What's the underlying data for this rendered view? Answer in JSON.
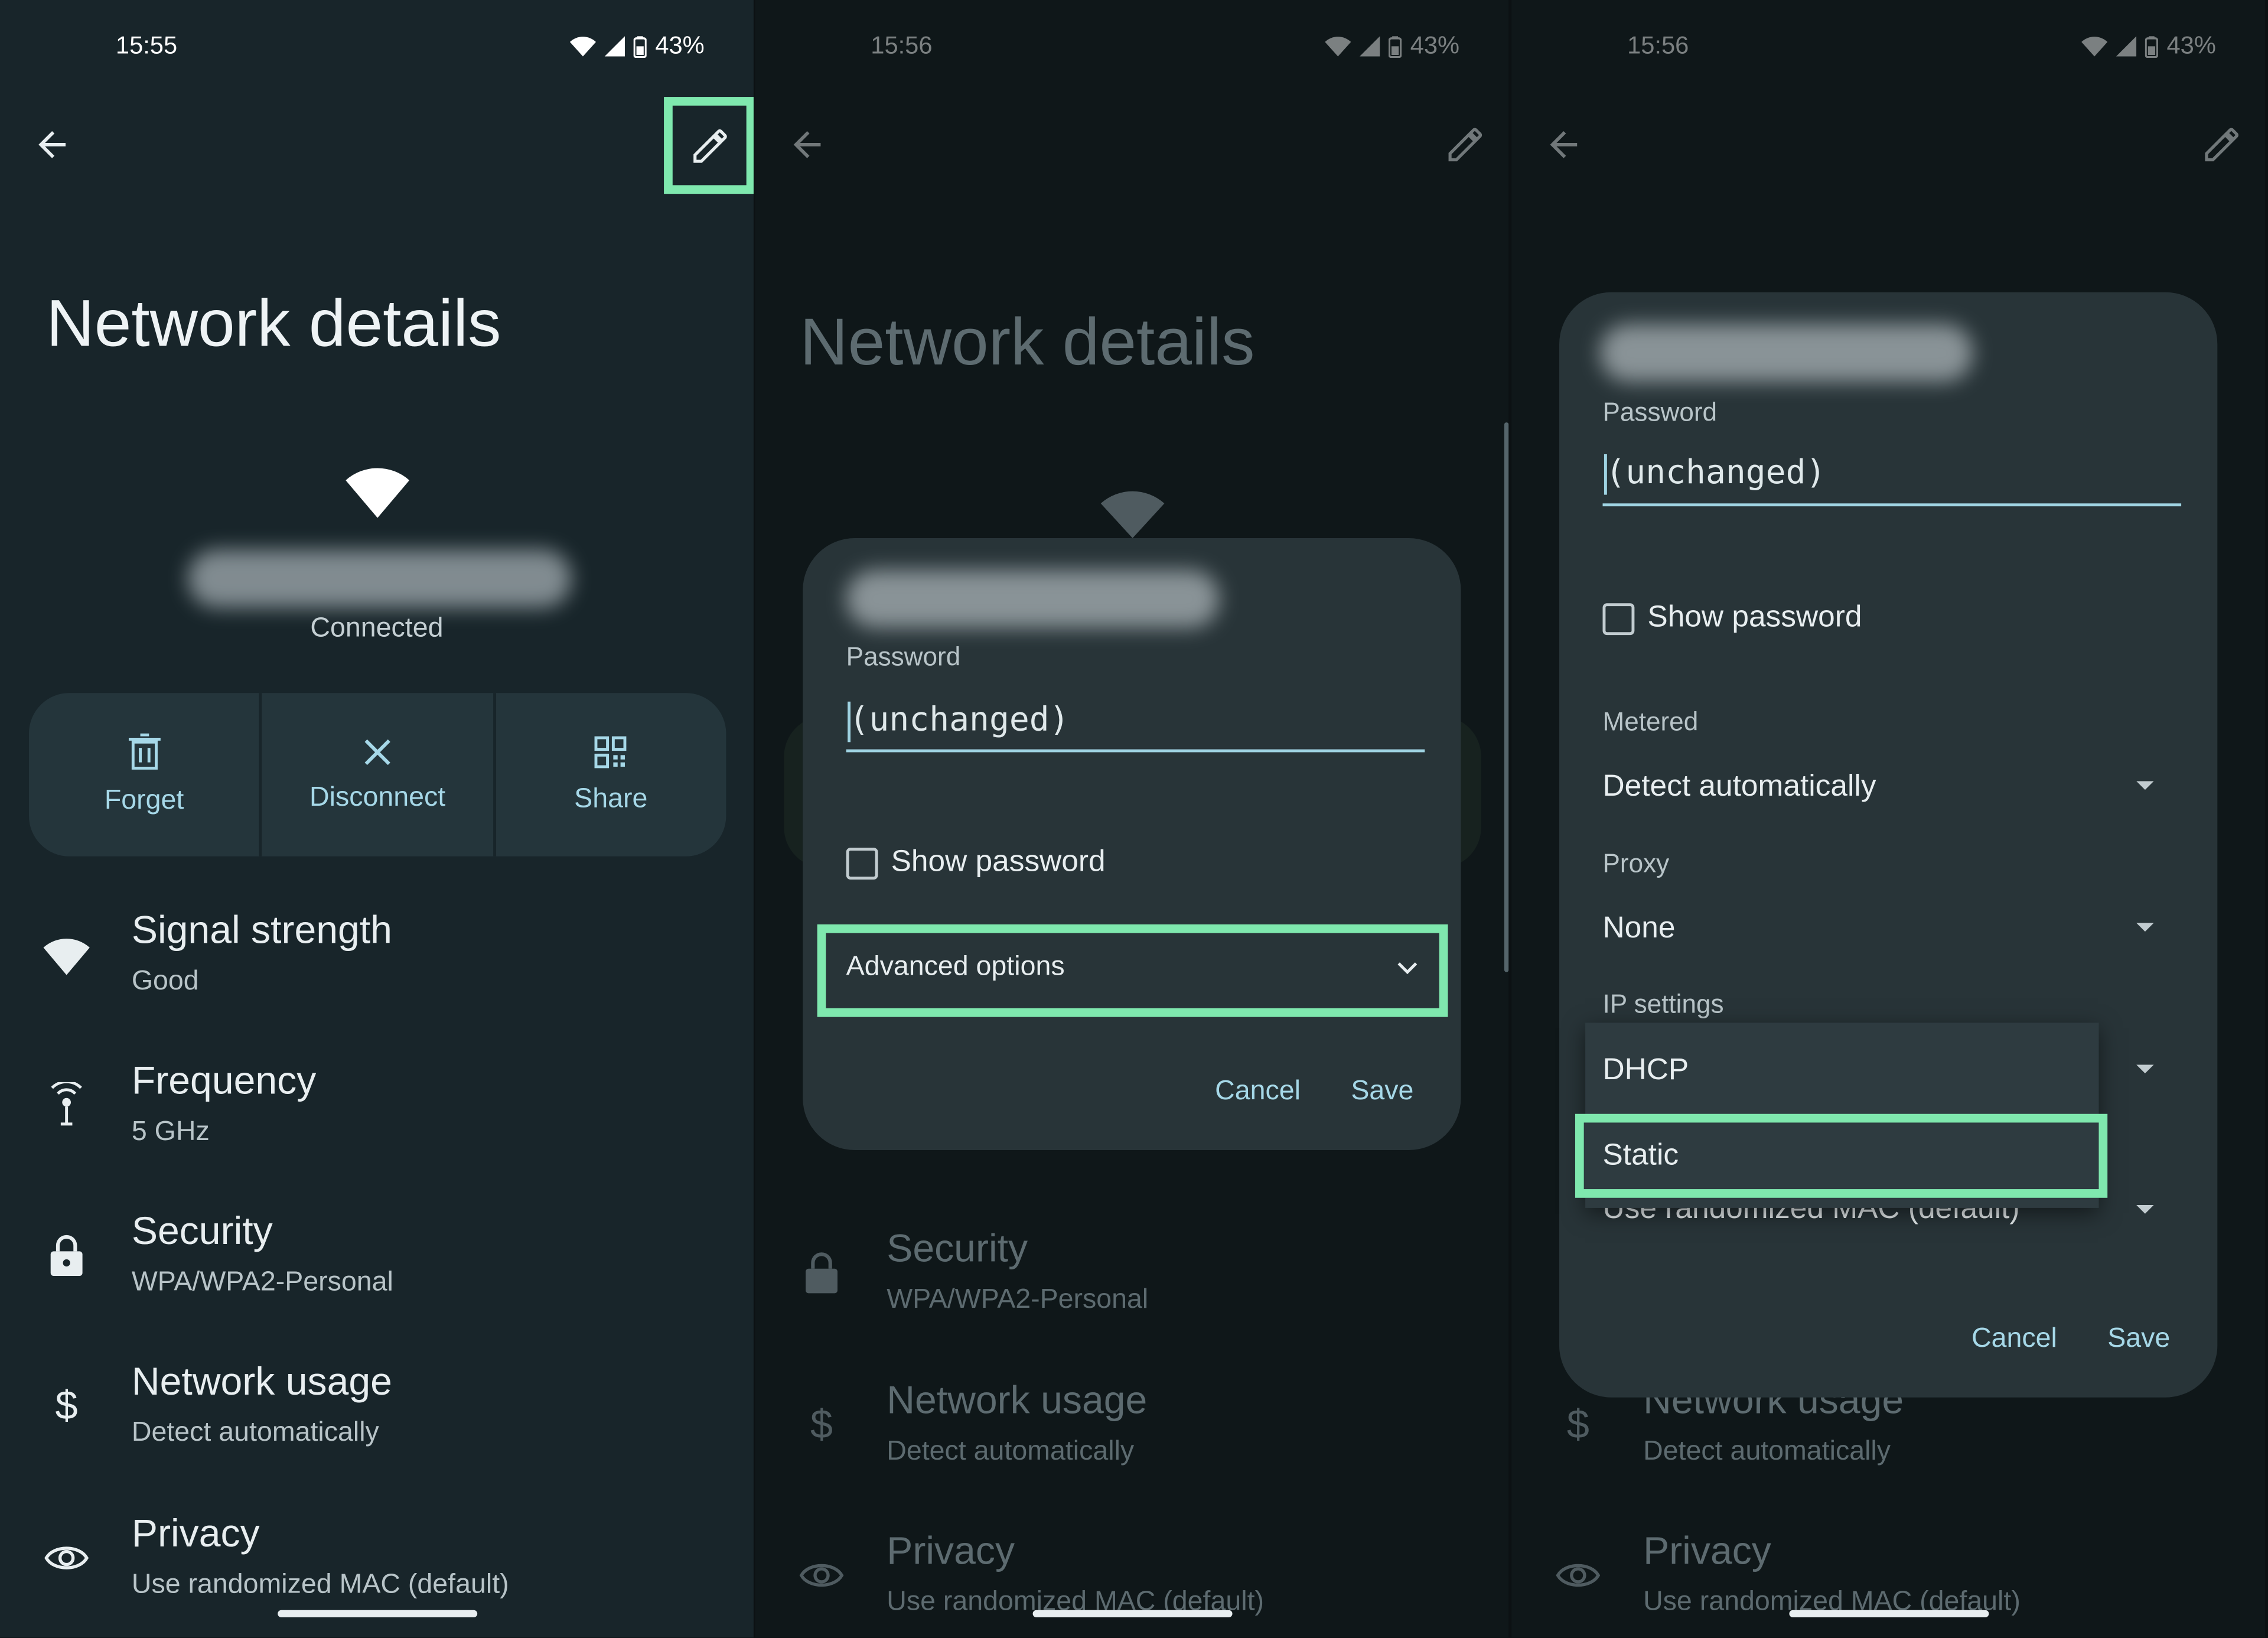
{
  "status": {
    "panel1": {
      "time": "15:55",
      "battery": "43%"
    },
    "panel2": {
      "time": "15:56",
      "battery": "43%"
    },
    "panel3": {
      "time": "15:56",
      "battery": "43%"
    }
  },
  "page": {
    "title": "Network details",
    "network_status": "Connected"
  },
  "actions": [
    {
      "label": "Forget",
      "icon": "trash-icon"
    },
    {
      "label": "Disconnect",
      "icon": "close-icon"
    },
    {
      "label": "Share",
      "icon": "qr-code-icon"
    }
  ],
  "details": [
    {
      "title": "Signal strength",
      "value": "Good",
      "icon": "wifi-icon"
    },
    {
      "title": "Frequency",
      "value": "5 GHz",
      "icon": "antenna-icon"
    },
    {
      "title": "Security",
      "value": "WPA/WPA2-Personal",
      "icon": "lock-icon"
    },
    {
      "title": "Network usage",
      "value": "Detect automatically",
      "icon": "dollar-icon"
    },
    {
      "title": "Privacy",
      "value": "Use randomized MAC (default)",
      "icon": "eye-icon"
    }
  ],
  "dialog": {
    "password_label": "Password",
    "password_value": "(unchanged)",
    "show_password": "Show password",
    "advanced_options": "Advanced options",
    "cancel": "Cancel",
    "save": "Save",
    "metered_label": "Metered",
    "metered_value": "Detect automatically",
    "proxy_label": "Proxy",
    "proxy_value": "None",
    "ip_label": "IP settings",
    "ip_options": [
      "DHCP",
      "Static"
    ],
    "privacy_value": "Use randomized MAC (default)"
  },
  "colors": {
    "highlight": "#7fe8ae",
    "accent": "#a6d8e8",
    "panel_bg": "#18252a",
    "dialog_bg": "#283438"
  }
}
